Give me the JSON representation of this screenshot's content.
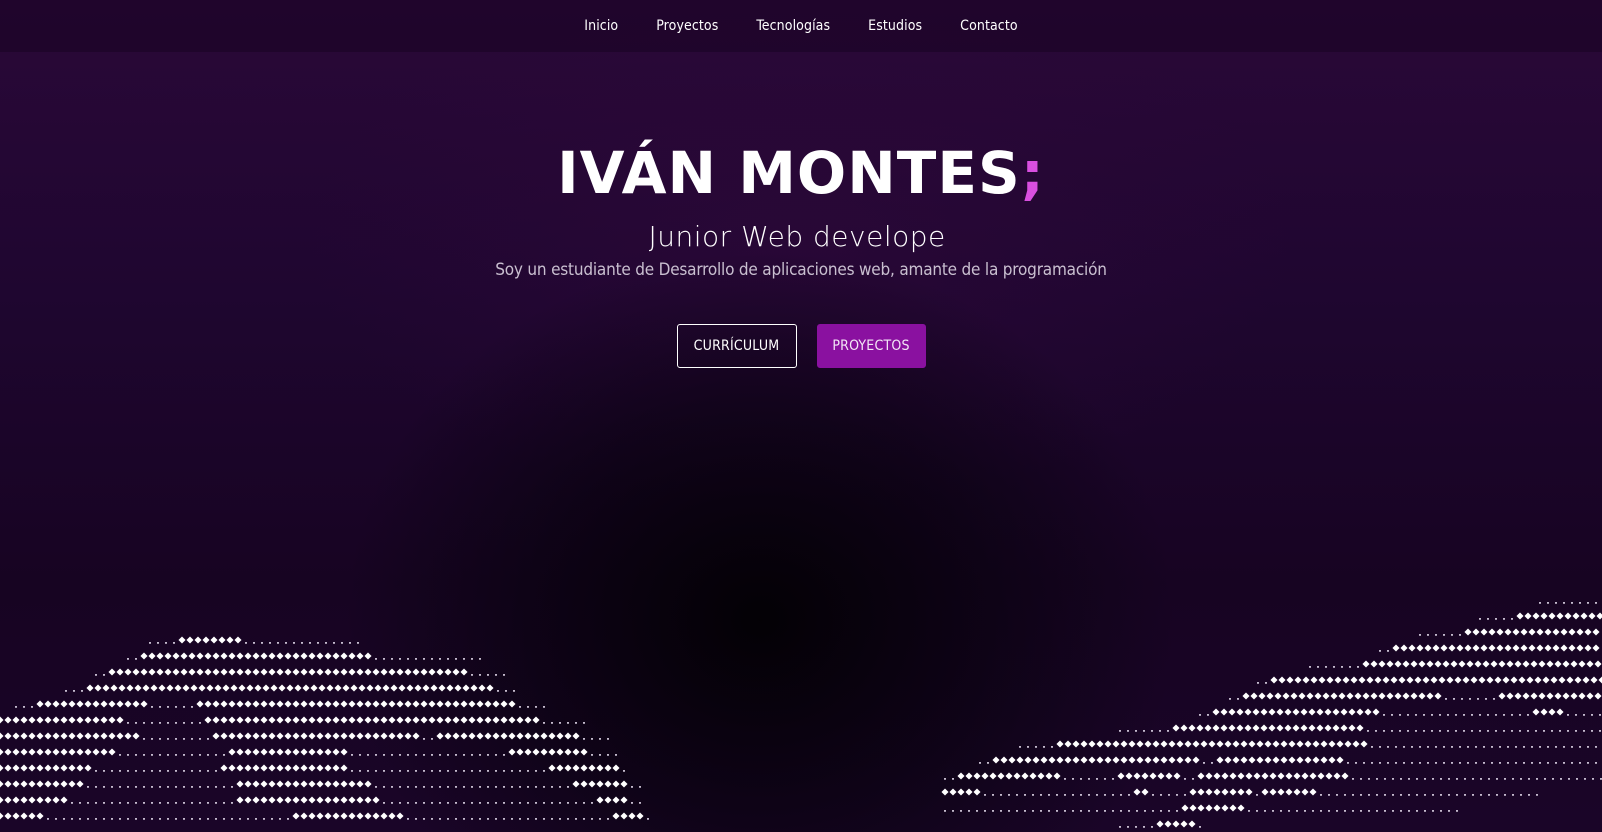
{
  "nav": {
    "items": [
      "Inicio",
      "Proyectos",
      "Tecnologías",
      "Estudios",
      "Contacto"
    ]
  },
  "hero": {
    "name": "IVÁN MONTES",
    "name_suffix": ";",
    "role": "Junior Web develope",
    "description": "Soy un estudiante de Desarrollo de aplicaciones web, amante de la programación"
  },
  "buttons": {
    "curriculum": "Currículum",
    "projects": "Proyectos"
  },
  "colors": {
    "accent": "#d94fe0",
    "button_primary": "#8a11a0",
    "background": "#1a0524"
  }
}
